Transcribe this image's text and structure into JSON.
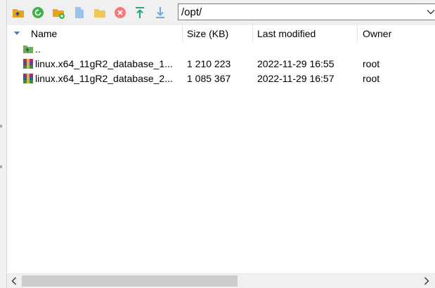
{
  "toolbar": {
    "buttons": [
      {
        "name": "parent-directory-icon",
        "color": "#e8a317"
      },
      {
        "name": "refresh-icon",
        "color": "#3cb04a"
      },
      {
        "name": "new-folder-icon",
        "color": "#e8a317"
      },
      {
        "name": "new-file-icon",
        "color": "#9cc2ea"
      },
      {
        "name": "open-folder-icon",
        "color": "#f3c65a"
      },
      {
        "name": "delete-icon",
        "color": "#f47a7a"
      },
      {
        "name": "upload-icon",
        "color": "#25a58a"
      },
      {
        "name": "download-icon",
        "color": "#6ba8e0"
      }
    ],
    "path": "/opt/"
  },
  "columns": [
    "Name",
    "Size (KB)",
    "Last modified",
    "Owner"
  ],
  "rows": [
    {
      "type": "parent",
      "name": "..",
      "size": "",
      "modified": "",
      "owner": ""
    },
    {
      "type": "archive",
      "name": "linux.x64_11gR2_database_1...",
      "size": "1 210 223",
      "modified": "2022-11-29 16:55",
      "owner": "root"
    },
    {
      "type": "archive",
      "name": "linux.x64_11gR2_database_2...",
      "size": "1 085 367",
      "modified": "2022-11-29 16:57",
      "owner": "root"
    }
  ]
}
